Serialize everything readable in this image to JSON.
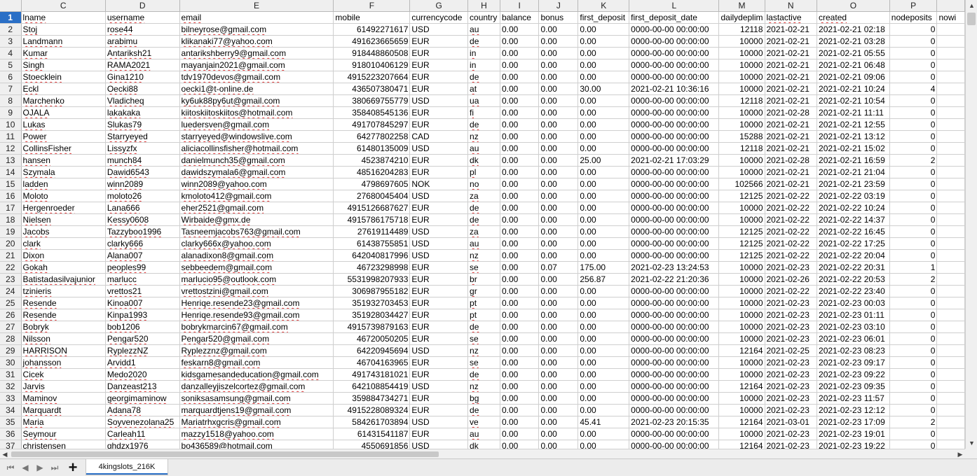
{
  "sheet": {
    "columns": [
      {
        "letter": "",
        "header": "1"
      },
      {
        "letter": "C",
        "header": "lname"
      },
      {
        "letter": "D",
        "header": "username"
      },
      {
        "letter": "E",
        "header": "email"
      },
      {
        "letter": "F",
        "header": "mobile"
      },
      {
        "letter": "G",
        "header": "currencycode"
      },
      {
        "letter": "H",
        "header": "country"
      },
      {
        "letter": "I",
        "header": "balance"
      },
      {
        "letter": "J",
        "header": "bonus"
      },
      {
        "letter": "K",
        "header": "first_deposit"
      },
      {
        "letter": "L",
        "header": "first_deposit_date"
      },
      {
        "letter": "M",
        "header": "dailydeplim"
      },
      {
        "letter": "N",
        "header": "lastactive"
      },
      {
        "letter": "O",
        "header": "created"
      },
      {
        "letter": "P",
        "header": "nodeposits"
      },
      {
        "letter": "",
        "header": "nowi"
      }
    ],
    "rows": [
      {
        "n": "2",
        "c": [
          "Stoj",
          "rose44",
          "bilneyrose@gmail.com",
          "61492271617",
          "USD",
          "au",
          "0.00",
          "0.00",
          "0.00",
          "0000-00-00 00:00:00",
          "12118",
          "2021-02-21",
          "2021-02-21 02:18",
          "0"
        ]
      },
      {
        "n": "3",
        "c": [
          "Landmann",
          "arabimu",
          "klikanaki77@yahoo.com",
          "491623665659",
          "EUR",
          "de",
          "0.00",
          "0.00",
          "0.00",
          "0000-00-00 00:00:00",
          "10000",
          "2021-02-21",
          "2021-02-21 03:28",
          "0"
        ]
      },
      {
        "n": "4",
        "c": [
          "Kumar",
          "Antariksh21",
          "antarikshberry9@gmail.com",
          "918448860508",
          "EUR",
          "in",
          "0.00",
          "0.00",
          "0.00",
          "0000-00-00 00:00:00",
          "10000",
          "2021-02-21",
          "2021-02-21 05:55",
          "0"
        ]
      },
      {
        "n": "5",
        "c": [
          "Singh",
          "RAMA2021",
          "mayanjain2021@gmail.com",
          "918010406129",
          "EUR",
          "in",
          "0.00",
          "0.00",
          "0.00",
          "0000-00-00 00:00:00",
          "10000",
          "2021-02-21",
          "2021-02-21 06:48",
          "0"
        ]
      },
      {
        "n": "6",
        "c": [
          "Stoecklein",
          "Gina1210",
          "tdv1970devos@gmail.com",
          "4915223207664",
          "EUR",
          "de",
          "0.00",
          "0.00",
          "0.00",
          "0000-00-00 00:00:00",
          "10000",
          "2021-02-21",
          "2021-02-21 09:06",
          "0"
        ]
      },
      {
        "n": "7",
        "c": [
          "Eckl",
          "Oecki88",
          "oecki1@t-online.de",
          "436507380471",
          "EUR",
          "at",
          "0.00",
          "0.00",
          "30.00",
          "2021-02-21 10:36:16",
          "10000",
          "2021-02-21",
          "2021-02-21 10:24",
          "4"
        ]
      },
      {
        "n": "8",
        "c": [
          "Marchenko",
          "Vladicheq",
          "ky6uk88py6ut@gmail.com",
          "380669755779",
          "USD",
          "ua",
          "0.00",
          "0.00",
          "0.00",
          "0000-00-00 00:00:00",
          "12118",
          "2021-02-21",
          "2021-02-21 10:54",
          "0"
        ]
      },
      {
        "n": "9",
        "c": [
          "OJALA",
          "lakakaka",
          "kiitoskiitoskiitos@hotmail.com",
          "358408545136",
          "EUR",
          "fi",
          "0.00",
          "0.00",
          "0.00",
          "0000-00-00 00:00:00",
          "10000",
          "2021-02-28",
          "2021-02-21 11:11",
          "0"
        ]
      },
      {
        "n": "10",
        "c": [
          "Lukas",
          "Slukas79",
          "luedersven@gmail.com",
          "491707845297",
          "EUR",
          "de",
          "0.00",
          "0.00",
          "0.00",
          "0000-00-00 00:00:00",
          "10000",
          "2021-02-21",
          "2021-02-21 12:55",
          "0"
        ]
      },
      {
        "n": "11",
        "c": [
          "Power",
          "Starryeyed",
          "starryeyed@windowslive.com",
          "64277802258",
          "CAD",
          "nz",
          "0.00",
          "0.00",
          "0.00",
          "0000-00-00 00:00:00",
          "15288",
          "2021-02-21",
          "2021-02-21 13:12",
          "0"
        ]
      },
      {
        "n": "12",
        "c": [
          "CollinsFisher",
          "Lissyzfx",
          "aliciacollinsfisher@hotmail.com",
          "61480135009",
          "USD",
          "au",
          "0.00",
          "0.00",
          "0.00",
          "0000-00-00 00:00:00",
          "12118",
          "2021-02-21",
          "2021-02-21 15:02",
          "0"
        ]
      },
      {
        "n": "13",
        "c": [
          "hansen",
          "munch84",
          "danielmunch35@gmail.com",
          "4523874210",
          "EUR",
          "dk",
          "0.00",
          "0.00",
          "25.00",
          "2021-02-21 17:03:29",
          "10000",
          "2021-02-28",
          "2021-02-21 16:59",
          "2"
        ]
      },
      {
        "n": "14",
        "c": [
          "Szymala",
          "Dawid6543",
          "dawidszymala6@gmail.com",
          "48516204283",
          "EUR",
          "pl",
          "0.00",
          "0.00",
          "0.00",
          "0000-00-00 00:00:00",
          "10000",
          "2021-02-21",
          "2021-02-21 21:04",
          "0"
        ]
      },
      {
        "n": "15",
        "c": [
          "ladden",
          "winn2089",
          "winn2089@yahoo.com",
          "4798697605",
          "NOK",
          "no",
          "0.00",
          "0.00",
          "0.00",
          "0000-00-00 00:00:00",
          "102566",
          "2021-02-21",
          "2021-02-21 23:59",
          "0"
        ]
      },
      {
        "n": "16",
        "c": [
          "Moloto",
          "moloto26",
          "kmoloto412@gmail.com",
          "27680045404",
          "USD",
          "za",
          "0.00",
          "0.00",
          "0.00",
          "0000-00-00 00:00:00",
          "12125",
          "2021-02-22",
          "2021-02-22 03:19",
          "0"
        ]
      },
      {
        "n": "17",
        "c": [
          "Hergenroeder",
          "Lana666",
          "eher2521@gmail.com",
          "4915126687627",
          "EUR",
          "de",
          "0.00",
          "0.00",
          "0.00",
          "0000-00-00 00:00:00",
          "10000",
          "2021-02-22",
          "2021-02-22 10:24",
          "0"
        ]
      },
      {
        "n": "18",
        "c": [
          "Nielsen",
          "Kessy0608",
          "Wirbaide@gmx.de",
          "4915786175718",
          "EUR",
          "de",
          "0.00",
          "0.00",
          "0.00",
          "0000-00-00 00:00:00",
          "10000",
          "2021-02-22",
          "2021-02-22 14:37",
          "0"
        ]
      },
      {
        "n": "19",
        "c": [
          "Jacobs",
          "Tazzyboo1996",
          "Tasneemjacobs763@gmail.com",
          "27619114489",
          "USD",
          "za",
          "0.00",
          "0.00",
          "0.00",
          "0000-00-00 00:00:00",
          "12125",
          "2021-02-22",
          "2021-02-22 16:45",
          "0"
        ]
      },
      {
        "n": "20",
        "c": [
          "clark",
          "clarky666",
          "clarky666x@yahoo.com",
          "61438755851",
          "USD",
          "au",
          "0.00",
          "0.00",
          "0.00",
          "0000-00-00 00:00:00",
          "12125",
          "2021-02-22",
          "2021-02-22 17:25",
          "0"
        ]
      },
      {
        "n": "21",
        "c": [
          "Dixon",
          "Alana007",
          "alanadixon8@gmail.com",
          "642040817996",
          "USD",
          "nz",
          "0.00",
          "0.00",
          "0.00",
          "0000-00-00 00:00:00",
          "12125",
          "2021-02-22",
          "2021-02-22 20:04",
          "0"
        ]
      },
      {
        "n": "22",
        "c": [
          "Gokah",
          "peoples99",
          "sebbeedem@gmail.com",
          "46723298998",
          "EUR",
          "se",
          "0.00",
          "0.07",
          "175.00",
          "2021-02-23 13:24:53",
          "10000",
          "2021-02-23",
          "2021-02-22 20:31",
          "1"
        ]
      },
      {
        "n": "23",
        "c": [
          "Batistadasilvajunior",
          "marlucc",
          "marlucio95@outlook.com",
          "5531998207933",
          "EUR",
          "br",
          "0.00",
          "0.00",
          "256.87",
          "2021-02-22 21:20:36",
          "10000",
          "2021-02-26",
          "2021-02-22 20:53",
          "2"
        ]
      },
      {
        "n": "24",
        "c": [
          "tzinieris",
          "vrettos21",
          "vrettostzini@gmail.com",
          "306987955182",
          "EUR",
          "gr",
          "0.00",
          "0.00",
          "0.00",
          "0000-00-00 00:00:00",
          "10000",
          "2021-02-22",
          "2021-02-22 23:40",
          "0"
        ]
      },
      {
        "n": "25",
        "c": [
          "Resende",
          "Kinoa007",
          "Henriqe.resende23@gmail.com",
          "351932703453",
          "EUR",
          "pt",
          "0.00",
          "0.00",
          "0.00",
          "0000-00-00 00:00:00",
          "10000",
          "2021-02-23",
          "2021-02-23 00:03",
          "0"
        ]
      },
      {
        "n": "26",
        "c": [
          "Resende",
          "Kinpa1993",
          "Henriqe.resende93@gmail.com",
          "351928034427",
          "EUR",
          "pt",
          "0.00",
          "0.00",
          "0.00",
          "0000-00-00 00:00:00",
          "10000",
          "2021-02-23",
          "2021-02-23 01:11",
          "0"
        ]
      },
      {
        "n": "27",
        "c": [
          "Bobryk",
          "bob1206",
          "bobrykmarcin67@gmail.com",
          "4915739879163",
          "EUR",
          "de",
          "0.00",
          "0.00",
          "0.00",
          "0000-00-00 00:00:00",
          "10000",
          "2021-02-23",
          "2021-02-23 03:10",
          "0"
        ]
      },
      {
        "n": "28",
        "c": [
          "Nilsson",
          "Pengar520",
          "Pengar520@gmail.com",
          "46720050205",
          "EUR",
          "se",
          "0.00",
          "0.00",
          "0.00",
          "0000-00-00 00:00:00",
          "10000",
          "2021-02-23",
          "2021-02-23 06:01",
          "0"
        ]
      },
      {
        "n": "29",
        "c": [
          "HARRISON",
          "RyplezzNZ",
          "Ryplezznz@gmail.com",
          "64220945694",
          "USD",
          "nz",
          "0.00",
          "0.00",
          "0.00",
          "0000-00-00 00:00:00",
          "12164",
          "2021-02-25",
          "2021-02-23 08:23",
          "0"
        ]
      },
      {
        "n": "30",
        "c": [
          "johansson",
          "Arvidd1",
          "feskarn8@gmail.com",
          "46704163965",
          "EUR",
          "se",
          "0.00",
          "0.00",
          "0.00",
          "0000-00-00 00:00:00",
          "10000",
          "2021-02-23",
          "2021-02-23 09:17",
          "0"
        ]
      },
      {
        "n": "31",
        "c": [
          "Cicek",
          "Medo2020",
          "kidsgamesandeducation@gmail.com",
          "491743181021",
          "EUR",
          "de",
          "0.00",
          "0.00",
          "0.00",
          "0000-00-00 00:00:00",
          "10000",
          "2021-02-23",
          "2021-02-23 09:22",
          "0"
        ]
      },
      {
        "n": "32",
        "c": [
          "Jarvis",
          "Danzeast213",
          "danzalleyjiszelcortez@gmail.com",
          "642108854419",
          "USD",
          "nz",
          "0.00",
          "0.00",
          "0.00",
          "0000-00-00 00:00:00",
          "12164",
          "2021-02-23",
          "2021-02-23 09:35",
          "0"
        ]
      },
      {
        "n": "33",
        "c": [
          "Maminov",
          "georgimaminow",
          "soniksasamsung@gmail.com",
          "359884734271",
          "EUR",
          "bg",
          "0.00",
          "0.00",
          "0.00",
          "0000-00-00 00:00:00",
          "10000",
          "2021-02-23",
          "2021-02-23 11:57",
          "0"
        ]
      },
      {
        "n": "34",
        "c": [
          "Marquardt",
          "Adana78",
          "marquardtjens19@gmail.com",
          "4915228089324",
          "EUR",
          "de",
          "0.00",
          "0.00",
          "0.00",
          "0000-00-00 00:00:00",
          "10000",
          "2021-02-23",
          "2021-02-23 12:12",
          "0"
        ]
      },
      {
        "n": "35",
        "c": [
          "Maria",
          "Soyvenezolana25",
          "Mariatrhxgcris@gmail.com",
          "584261703894",
          "USD",
          "ve",
          "0.00",
          "0.00",
          "45.41",
          "2021-02-23 20:15:35",
          "12164",
          "2021-03-01",
          "2021-02-23 17:09",
          "2"
        ]
      },
      {
        "n": "36",
        "c": [
          "Seymour",
          "Carleah11",
          "mazzy1518@yahoo.com",
          "61431541187",
          "EUR",
          "au",
          "0.00",
          "0.00",
          "0.00",
          "0000-00-00 00:00:00",
          "10000",
          "2021-02-23",
          "2021-02-23 19:01",
          "0"
        ]
      },
      {
        "n": "37",
        "c": [
          "christensen",
          "ghdzx1976",
          "bo436589@hotmail.com",
          "4550691856",
          "USD",
          "dk",
          "0.00",
          "0.00",
          "0.00",
          "0000-00-00 00:00:00",
          "12164",
          "2021-02-23",
          "2021-02-23 19:22",
          "0"
        ]
      }
    ]
  },
  "tabs": {
    "add_label": "+",
    "sheet_name": "4kingslots_216K"
  }
}
